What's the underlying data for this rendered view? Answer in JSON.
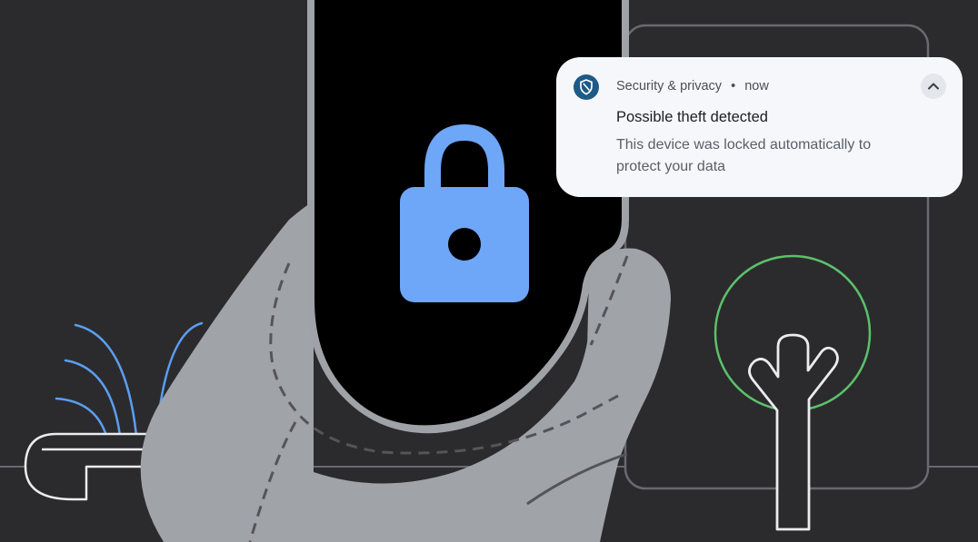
{
  "notification": {
    "app_name": "Security & privacy",
    "separator": "•",
    "time": "now",
    "title": "Possible theft detected",
    "body": "This device was locked automatically to protect your data",
    "app_icon": "shield-icon",
    "expand_icon": "chevron-up-icon"
  },
  "colors": {
    "background": "#2b2b2e",
    "phone_screen": "#000000",
    "lock": "#6ea6f8",
    "hand": "#a0a3a8",
    "tree_circle": "#5cc16a",
    "water": "#5b9ef0",
    "notification_bg": "#f5f7fb",
    "app_icon_bg": "#1d5a86"
  },
  "illustration": {
    "phone_icon": "padlock-icon",
    "hand": "hand-illustration",
    "left_element": "water-fountain-illustration",
    "right_element": "tree-in-circle-illustration"
  }
}
